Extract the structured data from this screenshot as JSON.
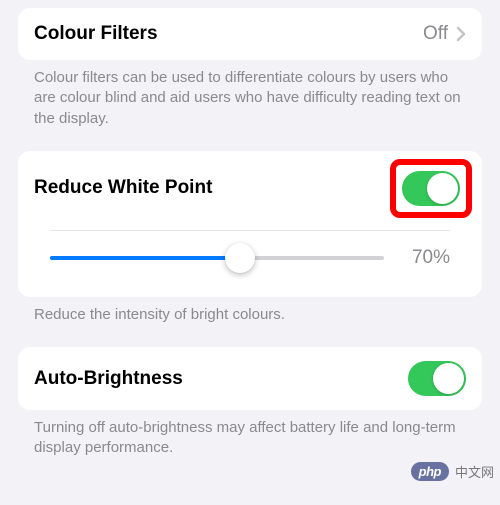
{
  "colors": {
    "accent_green": "#34c759",
    "accent_blue": "#007aff",
    "highlight_red": "#ff0000"
  },
  "colourFilters": {
    "label": "Colour Filters",
    "value": "Off",
    "footer": "Colour filters can be used to differentiate colours by users who are colour blind and aid users who have difficulty reading text on the display."
  },
  "reduceWhitePoint": {
    "label": "Reduce White Point",
    "enabled": true,
    "sliderPercent": 70,
    "sliderValueText": "70%",
    "sliderPositionPct": 57,
    "footer": "Reduce the intensity of bright colours."
  },
  "autoBrightness": {
    "label": "Auto-Brightness",
    "enabled": true,
    "footer": "Turning off auto-brightness may affect battery life and long-term display performance."
  },
  "watermark": {
    "badge": "php",
    "text": "中文网"
  }
}
